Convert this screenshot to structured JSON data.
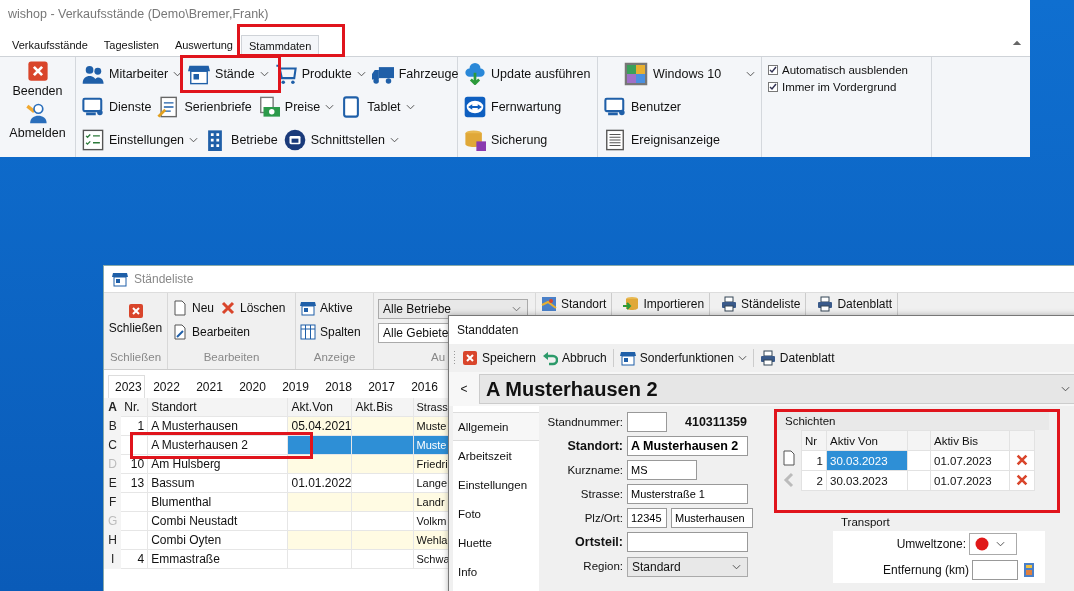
{
  "main_window": {
    "title": "wishop - Verkaufsstände (Demo\\Bremer,Frank)",
    "tabs": [
      {
        "label": "Verkaufsstände",
        "selected": false
      },
      {
        "label": "Tageslisten",
        "selected": false
      },
      {
        "label": "Auswertung",
        "selected": false
      },
      {
        "label": "Stammdaten",
        "selected": true
      }
    ],
    "ribbon": {
      "session_buttons": [
        "Beenden",
        "Abmelden"
      ],
      "master_data": [
        [
          {
            "label": "Mitarbeiter",
            "dropdown": true
          },
          {
            "label": "Stände",
            "dropdown": true
          },
          {
            "label": "Produkte",
            "dropdown": true
          },
          {
            "label": "Fahrzeuge",
            "dropdown": false
          }
        ],
        [
          {
            "label": "Dienste",
            "dropdown": false
          },
          {
            "label": "Serienbriefe",
            "dropdown": false
          },
          {
            "label": "Preise",
            "dropdown": true
          },
          {
            "label": "Tablet",
            "dropdown": true
          }
        ],
        [
          {
            "label": "Einstellungen",
            "dropdown": true
          },
          {
            "label": "Betriebe",
            "dropdown": false
          },
          {
            "label": "Schnittstellen",
            "dropdown": true
          }
        ]
      ],
      "maintenance": [
        "Update ausführen",
        "Fernwartung",
        "Sicherung"
      ],
      "theme_select": "Windows 10",
      "system": [
        "Benutzer",
        "Ereignisanzeige"
      ],
      "options": [
        {
          "label": "Automatisch ausblenden",
          "checked": true
        },
        {
          "label": "Immer im Vordergrund",
          "checked": true
        }
      ]
    }
  },
  "stand_list_window": {
    "title": "Ständeliste",
    "ribbon": {
      "close_button": "Schließen",
      "edit_buttons": [
        "Neu",
        "Löschen",
        "Bearbeiten"
      ],
      "view_buttons": [
        "Aktive",
        "Spalten"
      ],
      "filters": [
        "Alle Betriebe",
        "Alle Gebiete"
      ],
      "group_labels": [
        "Schließen",
        "Bearbeiten",
        "Anzeige",
        "Au"
      ],
      "actions": [
        "Standort",
        "Importieren",
        "Ständeliste",
        "Datenblatt"
      ]
    },
    "year_tabs": [
      {
        "label": "2023",
        "selected": true
      },
      {
        "label": "2022",
        "selected": false
      },
      {
        "label": "2021",
        "selected": false
      },
      {
        "label": "2020",
        "selected": false
      },
      {
        "label": "2019",
        "selected": false
      },
      {
        "label": "2018",
        "selected": false
      },
      {
        "label": "2017",
        "selected": false
      },
      {
        "label": "2016",
        "selected": false
      }
    ],
    "index_letters": [
      {
        "letter": "A",
        "selected": true,
        "disabled": false
      },
      {
        "letter": "B",
        "selected": false,
        "disabled": false
      },
      {
        "letter": "C",
        "selected": false,
        "disabled": false
      },
      {
        "letter": "D",
        "selected": false,
        "disabled": true
      },
      {
        "letter": "E",
        "selected": false,
        "disabled": false
      },
      {
        "letter": "F",
        "selected": false,
        "disabled": false
      },
      {
        "letter": "G",
        "selected": false,
        "disabled": true
      },
      {
        "letter": "H",
        "selected": false,
        "disabled": false
      },
      {
        "letter": "I",
        "selected": false,
        "disabled": false
      }
    ],
    "table": {
      "columns": [
        "Nr.",
        "Standort",
        "Akt.Von",
        "Akt.Bis",
        "Strass"
      ],
      "rows": [
        {
          "nr": "1",
          "location": "A Musterhausen",
          "active_from": "05.04.2021",
          "street": "Muste",
          "selected": false
        },
        {
          "location": "A Musterhausen 2",
          "street": "Muste",
          "selected": true
        },
        {
          "nr": "10",
          "location": "Am Hulsberg",
          "street": "Friedri",
          "selected": false
        },
        {
          "nr": "13",
          "location": "Bassum",
          "active_from": "01.01.2022",
          "street": "Lange",
          "selected": false
        },
        {
          "location": "Blumenthal",
          "street": "Landr",
          "selected": false
        },
        {
          "location": "Combi Neustadt",
          "street": "Volkm",
          "selected": false
        },
        {
          "location": "Combi Oyten",
          "street": "Wehla",
          "selected": false
        },
        {
          "nr": "4",
          "location": "Emmastraße",
          "street": "Schwa",
          "selected": false
        }
      ]
    }
  },
  "stand_data_window": {
    "title": "Standdaten",
    "toolbar": [
      {
        "label": "Speichern",
        "dropdown": false
      },
      {
        "label": "Abbruch",
        "dropdown": false
      },
      {
        "label": "Sonderfunktionen",
        "dropdown": true
      },
      {
        "label": "Datenblatt",
        "dropdown": false
      }
    ],
    "nav_button": "<",
    "record_title": "A Musterhausen 2",
    "side_tabs": [
      {
        "label": "Allgemein",
        "selected": true
      },
      {
        "label": "Arbeitszeit",
        "selected": false
      },
      {
        "label": "Einstellungen",
        "selected": false
      },
      {
        "label": "Foto",
        "selected": false
      },
      {
        "label": "Huette",
        "selected": false
      },
      {
        "label": "Info",
        "selected": false
      }
    ],
    "form": [
      {
        "label": "Standnummer:",
        "kind": "number",
        "emphasized": false,
        "suffix": "410311359"
      },
      {
        "label": "Standort:",
        "kind": "text",
        "emphasized": true,
        "value": "A Musterhausen 2"
      },
      {
        "label": "Kurzname:",
        "kind": "short",
        "emphasized": false,
        "value": "MS"
      },
      {
        "label": "Strasse:",
        "kind": "text",
        "emphasized": false,
        "value": "Musterstraße 1"
      },
      {
        "label": "Plz/Ort:",
        "kind": "split",
        "emphasized": false,
        "values": [
          "12345",
          "Musterhausen"
        ]
      },
      {
        "label": "Ortsteil:",
        "kind": "text",
        "emphasized": true
      },
      {
        "label": "Region:",
        "kind": "select",
        "emphasized": false,
        "value": "Standard"
      }
    ],
    "shifts": {
      "title": "Schichten",
      "columns": [
        "Nr",
        "Aktiv Von",
        "Aktiv Bis"
      ],
      "rows": [
        {
          "nr": "1",
          "from": "30.03.2023",
          "to": "01.07.2023",
          "selected": true
        },
        {
          "nr": "2",
          "from": "30.03.2023",
          "to": "01.07.2023",
          "selected": false
        }
      ]
    },
    "transport": {
      "title": "Transport",
      "fields": [
        {
          "label": "Umweltzone:",
          "kind": "zone"
        },
        {
          "label": "Entfernung (km)",
          "kind": "input"
        }
      ]
    }
  }
}
